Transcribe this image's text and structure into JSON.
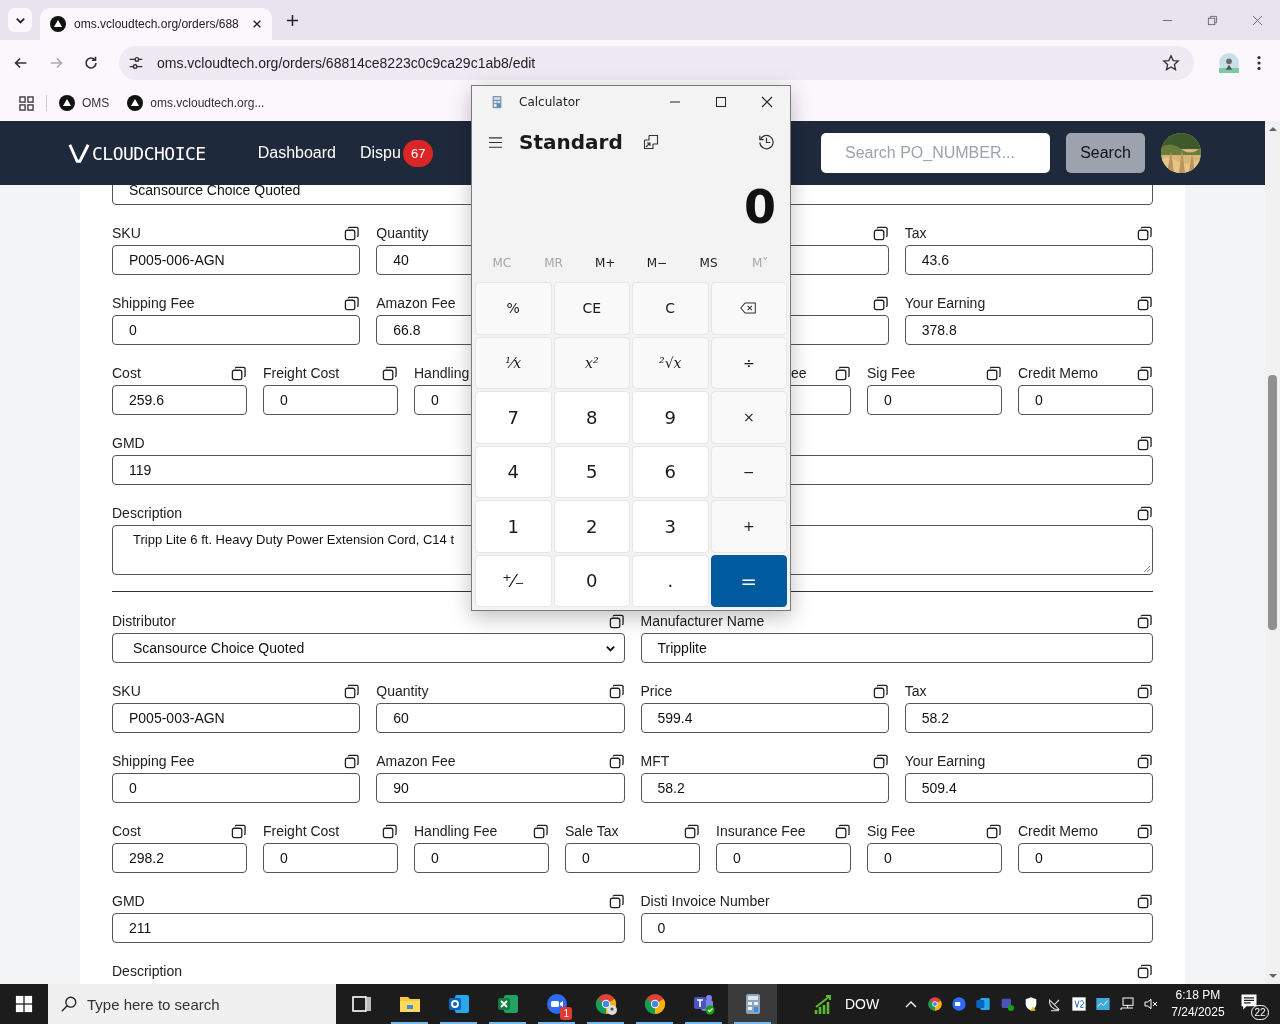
{
  "browser": {
    "tabs": [
      {
        "title": "oms.vcloudtech.org/orders/688",
        "selected": true
      }
    ],
    "nav_buttons": [
      {
        "kind": "back",
        "disabled": false
      },
      {
        "kind": "forward",
        "disabled": true
      },
      {
        "kind": "reload",
        "disabled": false
      }
    ],
    "address": "oms.vcloudtech.org/orders/68814ce8223c0c9ca29c1ab8/edit",
    "bookmarks": [
      {
        "label": "OMS"
      },
      {
        "label": "oms.vcloudtech.org..."
      }
    ]
  },
  "navbar": {
    "logo": "CLOUDCHOICE",
    "links": [
      {
        "label": "Dashboard"
      },
      {
        "label": "Dispu",
        "badge": "67"
      }
    ],
    "search": {
      "placeholder": "Search PO_NUMBER..."
    },
    "search_button": "Search"
  },
  "sections": [
    {
      "rows": [
        {
          "fields": [
            {
              "kind": "input",
              "value": "Scansource Choice Quoted",
              "copy": false
            },
            {
              "kind": "input",
              "copy": false
            }
          ]
        },
        {
          "fields": [
            {
              "kind": "input",
              "label": "SKU",
              "value": "P005-006-AGN",
              "copy": true
            },
            {
              "kind": "input",
              "label": "Quantity",
              "value": "40",
              "copy": false
            },
            {
              "kind": "input",
              "copy": true
            },
            {
              "kind": "input",
              "label": "Tax",
              "value": "43.6",
              "copy": true
            }
          ]
        },
        {
          "fields": [
            {
              "kind": "input",
              "label": "Shipping Fee",
              "value": "0",
              "copy": true
            },
            {
              "kind": "input",
              "label": "Amazon Fee",
              "value": "66.8",
              "copy": false
            },
            {
              "kind": "input",
              "copy": true
            },
            {
              "kind": "input",
              "label": "Your Earning",
              "value": "378.8",
              "copy": true
            }
          ]
        },
        {
          "fields": [
            {
              "kind": "input",
              "label": "Cost",
              "value": "259.6",
              "copy": true
            },
            {
              "kind": "input",
              "label": "Freight Cost",
              "value": "0",
              "copy": true
            },
            {
              "kind": "input",
              "label": "Handling",
              "value": "0",
              "copy": false
            },
            {
              "kind": "gap"
            },
            {
              "kind": "input",
              "label": "ee",
              "label_cut": true,
              "copy": true
            },
            {
              "kind": "input",
              "label": "Sig Fee",
              "value": "0",
              "copy": true
            },
            {
              "kind": "input",
              "label": "Credit Memo",
              "value": "0",
              "copy": true
            }
          ]
        },
        {
          "fields": [
            {
              "kind": "input",
              "label": "GMD",
              "value": "119",
              "copy": false
            },
            {
              "kind": "input",
              "copy": true
            }
          ]
        },
        {
          "fields": [
            {
              "kind": "textarea",
              "label": "Description",
              "value": "Tripp Lite 6 ft. Heavy Duty Power Extension Cord, C14 t",
              "copy": true
            }
          ]
        }
      ]
    },
    {
      "rows": [
        {
          "fields": [
            {
              "kind": "select",
              "label": "Distributor",
              "value": "Scansource Choice Quoted",
              "copy": true
            },
            {
              "kind": "input",
              "label": "Manufacturer Name",
              "value": "Tripplite",
              "copy": true
            }
          ]
        },
        {
          "fields": [
            {
              "kind": "input",
              "label": "SKU",
              "value": "P005-003-AGN",
              "copy": true
            },
            {
              "kind": "input",
              "label": "Quantity",
              "value": "60",
              "copy": true
            },
            {
              "kind": "input",
              "label": "Price",
              "value": "599.4",
              "copy": true
            },
            {
              "kind": "input",
              "label": "Tax",
              "value": "58.2",
              "copy": true
            }
          ]
        },
        {
          "fields": [
            {
              "kind": "input",
              "label": "Shipping Fee",
              "value": "0",
              "copy": true
            },
            {
              "kind": "input",
              "label": "Amazon Fee",
              "value": "90",
              "copy": true
            },
            {
              "kind": "input",
              "label": "MFT",
              "value": "58.2",
              "copy": true
            },
            {
              "kind": "input",
              "label": "Your Earning",
              "value": "509.4",
              "copy": true
            }
          ]
        },
        {
          "fields": [
            {
              "kind": "input",
              "label": "Cost",
              "value": "298.2",
              "copy": true
            },
            {
              "kind": "input",
              "label": "Freight Cost",
              "value": "0",
              "copy": true
            },
            {
              "kind": "input",
              "label": "Handling Fee",
              "value": "0",
              "copy": true
            },
            {
              "kind": "input",
              "label": "Sale Tax",
              "value": "0",
              "copy": true
            },
            {
              "kind": "input",
              "label": "Insurance Fee",
              "value": "0",
              "copy": true
            },
            {
              "kind": "input",
              "label": "Sig Fee",
              "value": "0",
              "copy": true
            },
            {
              "kind": "input",
              "label": "Credit Memo",
              "value": "0",
              "copy": true
            }
          ]
        },
        {
          "fields": [
            {
              "kind": "input",
              "label": "GMD",
              "value": "211",
              "copy": true
            },
            {
              "kind": "input",
              "label": "Disti Invoice Number",
              "value": "0",
              "copy": true
            }
          ]
        },
        {
          "fields": [
            {
              "kind": "label",
              "label": "Description",
              "copy": true
            }
          ]
        }
      ]
    }
  ],
  "calculator": {
    "title": "Calculator",
    "mode": "Standard",
    "display": "0",
    "memory": [
      {
        "label": "MC",
        "disabled": true
      },
      {
        "label": "MR",
        "disabled": true
      },
      {
        "label": "M+",
        "disabled": false
      },
      {
        "label": "M−",
        "disabled": false
      },
      {
        "label": "MS",
        "disabled": false
      },
      {
        "label": "M˅",
        "disabled": true
      }
    ],
    "keys": [
      {
        "kind": "fn",
        "label": "%"
      },
      {
        "kind": "fn",
        "label": "CE"
      },
      {
        "kind": "fn",
        "label": "C"
      },
      {
        "kind": "backspace"
      },
      {
        "kind": "math",
        "label": "¹⁄x"
      },
      {
        "kind": "math",
        "label": "x²"
      },
      {
        "kind": "math",
        "label": "²√x"
      },
      {
        "kind": "fn",
        "label": "÷"
      },
      {
        "kind": "num",
        "label": "7"
      },
      {
        "kind": "num",
        "label": "8"
      },
      {
        "kind": "num",
        "label": "9"
      },
      {
        "kind": "fn",
        "label": "×"
      },
      {
        "kind": "num",
        "label": "4"
      },
      {
        "kind": "num",
        "label": "5"
      },
      {
        "kind": "num",
        "label": "6"
      },
      {
        "kind": "fn",
        "label": "−"
      },
      {
        "kind": "num",
        "label": "1"
      },
      {
        "kind": "num",
        "label": "2"
      },
      {
        "kind": "num",
        "label": "3"
      },
      {
        "kind": "fn",
        "label": "+"
      },
      {
        "kind": "num",
        "label": "⁺⁄₋"
      },
      {
        "kind": "num",
        "label": "0"
      },
      {
        "kind": "num",
        "label": "."
      },
      {
        "kind": "eq",
        "label": "="
      }
    ]
  },
  "taskbar": {
    "search_placeholder": "Type here to search",
    "apps": [
      {
        "kind": "taskview",
        "running": false,
        "selected": false
      },
      {
        "kind": "folder",
        "running": true,
        "selected": false
      },
      {
        "kind": "outlook",
        "running": true,
        "selected": false
      },
      {
        "kind": "excel",
        "running": true,
        "selected": false
      },
      {
        "kind": "zoom",
        "running": true,
        "selected": false,
        "badge": "1"
      },
      {
        "kind": "chrome-profile",
        "running": true,
        "selected": false
      },
      {
        "kind": "chrome",
        "running": true,
        "selected": false
      },
      {
        "kind": "teams",
        "running": true,
        "selected": false
      },
      {
        "kind": "calculator",
        "running": true,
        "selected": true
      }
    ],
    "widget": "DOW",
    "tray": [
      {
        "kind": "caret"
      },
      {
        "kind": "chrome"
      },
      {
        "kind": "zoom"
      },
      {
        "kind": "outlook"
      },
      {
        "kind": "teams"
      },
      {
        "kind": "shield"
      },
      {
        "kind": "satellite"
      },
      {
        "kind": "vpn"
      },
      {
        "kind": "monitor"
      },
      {
        "kind": "network"
      },
      {
        "kind": "volume-muted"
      }
    ],
    "time": "6:18 PM",
    "date": "7/24/2025",
    "notifications": "22"
  }
}
